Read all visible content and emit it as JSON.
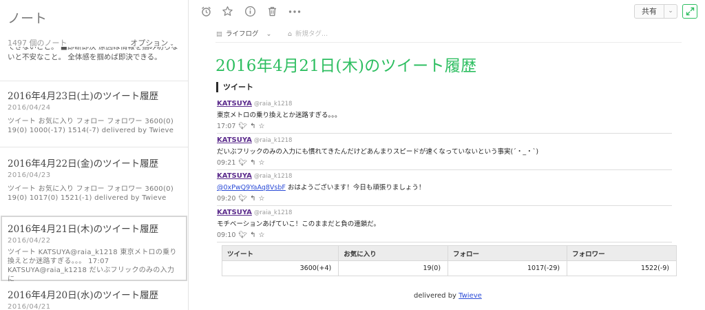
{
  "sidebar": {
    "title": "ノート",
    "count": "1497 個のノート",
    "options": "オプション",
    "top_snippet_line1": "できないこと。 ■即断即決 原因は情報を掴み切らないと不安なこと。 全体感を掴めば即決できる。",
    "top_snippet": "できないこと。 ■即断即決 原因は情報を掴み切らないと不安なこと。 全体感を掴めば即決できる。",
    "notes": [
      {
        "title": "2016年4月23日(土)のツイート履歴",
        "date": "2016/04/24",
        "snippet": "ツイート お気に入り フォロー フォロワー 3600(0) 19(0) 1000(-17) 1514(-7) delivered by Twieve"
      },
      {
        "title": "2016年4月22日(金)のツイート履歴",
        "date": "2016/04/23",
        "snippet": "ツイート お気に入り フォロー フォロワー 3600(0) 19(0) 1017(0) 1521(-1) delivered by Twieve"
      },
      {
        "title": "2016年4月21日(木)のツイート履歴",
        "date": "2016/04/22",
        "snippet": "ツイート KATSUYA@raia_k1218 東京メトロの乗り換えとか迷路すぎる。。。 17:07 KATSUYA@raia_k1218 だいぶフリックのみの入力に"
      },
      {
        "title": "2016年4月20日(水)のツイート履歴",
        "date": "2016/04/21",
        "snippet": ""
      }
    ]
  },
  "toolbar": {
    "share_label": "共有"
  },
  "meta": {
    "notebook": "ライフログ",
    "tag_placeholder": "新規タグ..."
  },
  "note": {
    "heading": "2016年4月21日(木)のツイート履歴",
    "section_title": "ツイート",
    "tweets": [
      {
        "user": "KATSUYA",
        "handle": "@raia_k1218",
        "link": "",
        "text": "東京メトロの乗り換えとか迷路すぎる。。。",
        "time": "17:07"
      },
      {
        "user": "KATSUYA",
        "handle": "@raia_k1218",
        "link": "",
        "text": "だいぶフリックのみの入力にも慣れてきたんだけどあんまりスピードが速くなっていないという事実(´・_・`)",
        "time": "09:21"
      },
      {
        "user": "KATSUYA",
        "handle": "@raia_k1218",
        "link": "@0xPwQ9YaAq8VsbF",
        "text": " おはようございます！今日も頑張りましょう！",
        "time": "09:20"
      },
      {
        "user": "KATSUYA",
        "handle": "@raia_k1218",
        "link": "",
        "text": "モチベーションあげていこ！このままだと負の連鎖だ。",
        "time": "09:10"
      }
    ],
    "stats": {
      "headers": [
        "ツイート",
        "お気に入り",
        "フォロー",
        "フォロワー"
      ],
      "values": [
        "3600(+4)",
        "19(0)",
        "1017(-29)",
        "1522(-9)"
      ]
    },
    "delivered_prefix": "delivered by",
    "delivered_link": "Twieve"
  }
}
